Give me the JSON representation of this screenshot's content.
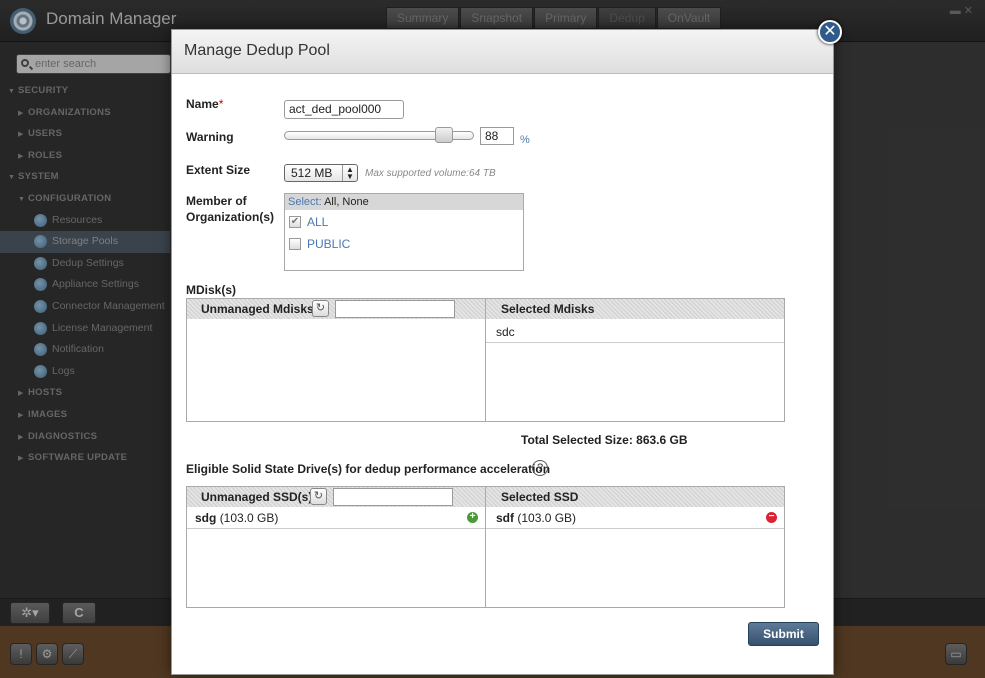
{
  "app": {
    "title": "Domain Manager"
  },
  "tabs": [
    {
      "label": "Summary"
    },
    {
      "label": "Snapshot"
    },
    {
      "label": "Primary"
    },
    {
      "label": "Dedup"
    },
    {
      "label": "OnVault"
    }
  ],
  "sidebar": {
    "search_placeholder": "enter search",
    "items": [
      {
        "label": "SECURITY"
      },
      {
        "label": "ORGANIZATIONS"
      },
      {
        "label": "USERS"
      },
      {
        "label": "ROLES"
      },
      {
        "label": "SYSTEM"
      },
      {
        "label": "CONFIGURATION"
      },
      {
        "label": "Resources"
      },
      {
        "label": "Storage Pools"
      },
      {
        "label": "Dedup Settings"
      },
      {
        "label": "Appliance Settings"
      },
      {
        "label": "Connector Management"
      },
      {
        "label": "License Management"
      },
      {
        "label": "Notification"
      },
      {
        "label": "Logs"
      },
      {
        "label": "HOSTS"
      },
      {
        "label": "IMAGES"
      },
      {
        "label": "DIAGNOSTICS"
      },
      {
        "label": "SOFTWARE UPDATE"
      }
    ]
  },
  "modal": {
    "title": "Manage Dedup Pool",
    "name_label": "Name",
    "name_required": "*",
    "name_value": "act_ded_pool000",
    "warning_label": "Warning",
    "warning_value": "88",
    "warning_unit": "%",
    "warning_level": 0.88,
    "extent_label": "Extent Size",
    "extent_value": "512 MB",
    "extent_note": "Max supported volume:64 TB",
    "member_label_1": "Member of",
    "member_label_2": "Organization(s)",
    "org_select_word": "Select:",
    "org_select_options": "All, None",
    "orgs": [
      {
        "label": "ALL",
        "checked": true
      },
      {
        "label": "PUBLIC",
        "checked": false
      }
    ],
    "mdisk_label": "MDisk(s)",
    "mdisk_unmanaged_header": "Unmanaged Mdisks",
    "mdisk_selected_header": "Selected Mdisks",
    "mdisk_selected": [
      "sdc"
    ],
    "total_size": "Total Selected Size: 863.6 GB",
    "ssd_label": "Eligible Solid State Drive(s) for dedup performance acceleration",
    "ssd_unmanaged_header": "Unmanaged SSD(s)",
    "ssd_selected_header": "Selected SSD",
    "ssd_unmanaged": [
      {
        "name": "sdg",
        "size": "(103.0 GB)"
      }
    ],
    "ssd_selected": [
      {
        "name": "sdf",
        "size": "(103.0 GB)"
      }
    ],
    "submit_label": "Submit"
  },
  "colors": {
    "accent": "#2f5a8a",
    "link": "#4a78b0",
    "add": "#4a9a3a",
    "remove": "#dd2233"
  }
}
